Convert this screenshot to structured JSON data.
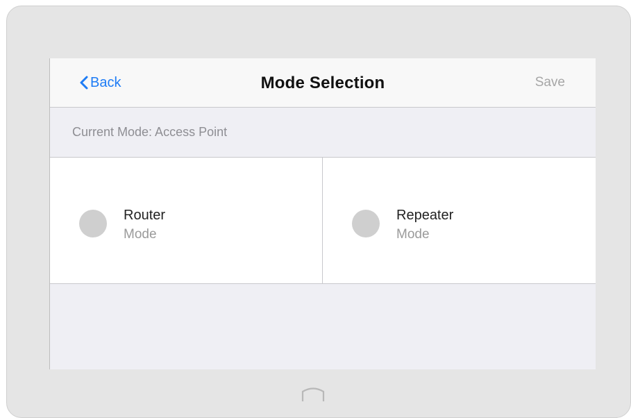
{
  "navbar": {
    "back_label": "Back",
    "title": "Mode Selection",
    "save_label": "Save"
  },
  "current_mode": {
    "text": "Current Mode: Access Point"
  },
  "modes": [
    {
      "name": "Router",
      "sub": "Mode",
      "selected": false
    },
    {
      "name": "Repeater",
      "sub": "Mode",
      "selected": false
    }
  ],
  "colors": {
    "accent": "#1e7cf5",
    "radio_unselected": "#cfcfcf",
    "device_frame": "#e5e5e5"
  },
  "icons": {
    "back": "chevron-left-icon",
    "home": "home-button-icon"
  }
}
